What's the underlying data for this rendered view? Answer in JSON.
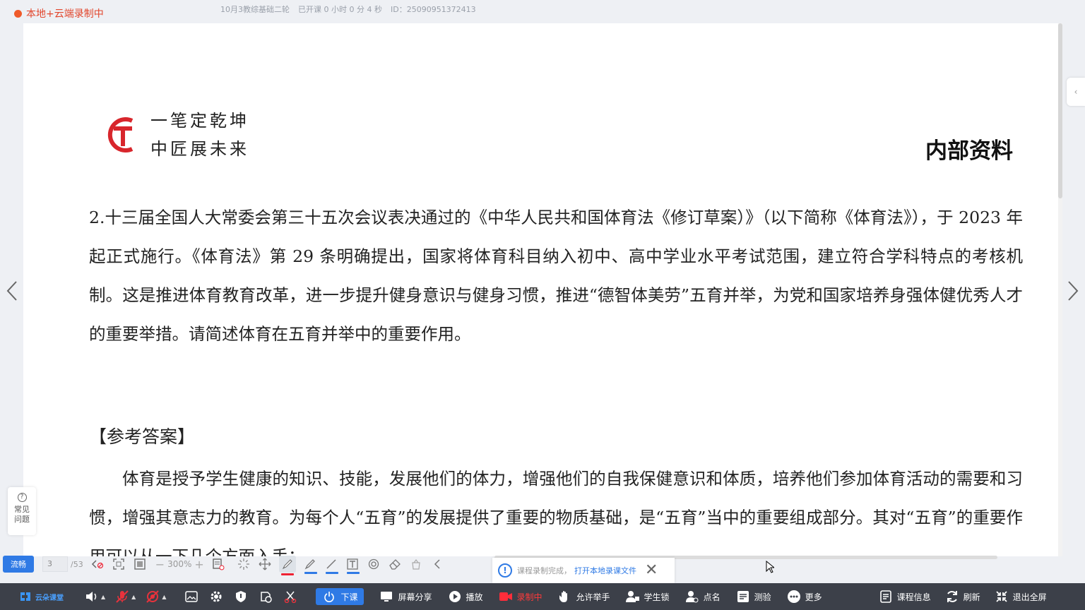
{
  "recording_status": "本地+云端录制中",
  "class_info": {
    "name": "10月3教综基础二轮",
    "elapsed": "已开课 0 小时 0 分 4 秒",
    "id": "ID：25090951372413"
  },
  "document": {
    "slogan_line1": "一笔定乾坤",
    "slogan_line2": "中匠展未来",
    "badge": "内部资料",
    "question": "2.十三届全国人大常委会第三十五次会议表决通过的《中华人民共和国体育法《修订草案）》（以下简称《体育法》），于 2023 年起正式施行。《体育法》第 29 条明确提出，国家将体育科目纳入初中、高中学业水平考试范围，建立符合学科特点的考核机制。这是推进体育教育改革，进一步提升健身意识与健身习惯，推进“德智体美劳”五育并举，为党和国家培养身强体健优秀人才的重要举措。请简述体育在五育并举中的重要作用。",
    "answer_heading": "【参考答案】",
    "answer": "体育是授予学生健康的知识、技能，发展他们的体力，增强他们的自我保健意识和体质，培养他们参加体育活动的需要和习惯，增强其意志力的教育。为每个人“五育”的发展提供了重要的物质基础，是“五育”当中的重要组成部分。其对“五育”的重要作用可以从一下几个方面入手："
  },
  "faq": {
    "line1": "常见",
    "line2": "问题"
  },
  "doc_toolbar": {
    "mode_button": "流畅",
    "page_current": "3",
    "page_total": "/53",
    "zoom_level": "300%",
    "zoom_minus": "−",
    "zoom_plus": "+"
  },
  "toast": {
    "message": "课程录制完成，",
    "link": "打开本地录课文件",
    "close": "✕"
  },
  "bottom_bar": {
    "brand": "云朵课堂",
    "end_class": "下课",
    "screen_share": "屏幕分享",
    "play": "播放",
    "recording": "录制中",
    "allow_hand_raise": "允许举手",
    "student_lock": "学生锁",
    "roll_call": "点名",
    "quiz": "测验",
    "more": "更多",
    "course_info": "课程信息",
    "refresh": "刷新",
    "exit_fullscreen": "退出全屏"
  },
  "colors": {
    "accent": "#2f7ae5",
    "recording_red": "#e2462c",
    "logo_red": "#d8262c",
    "bottom_bar": "#3c4049"
  }
}
